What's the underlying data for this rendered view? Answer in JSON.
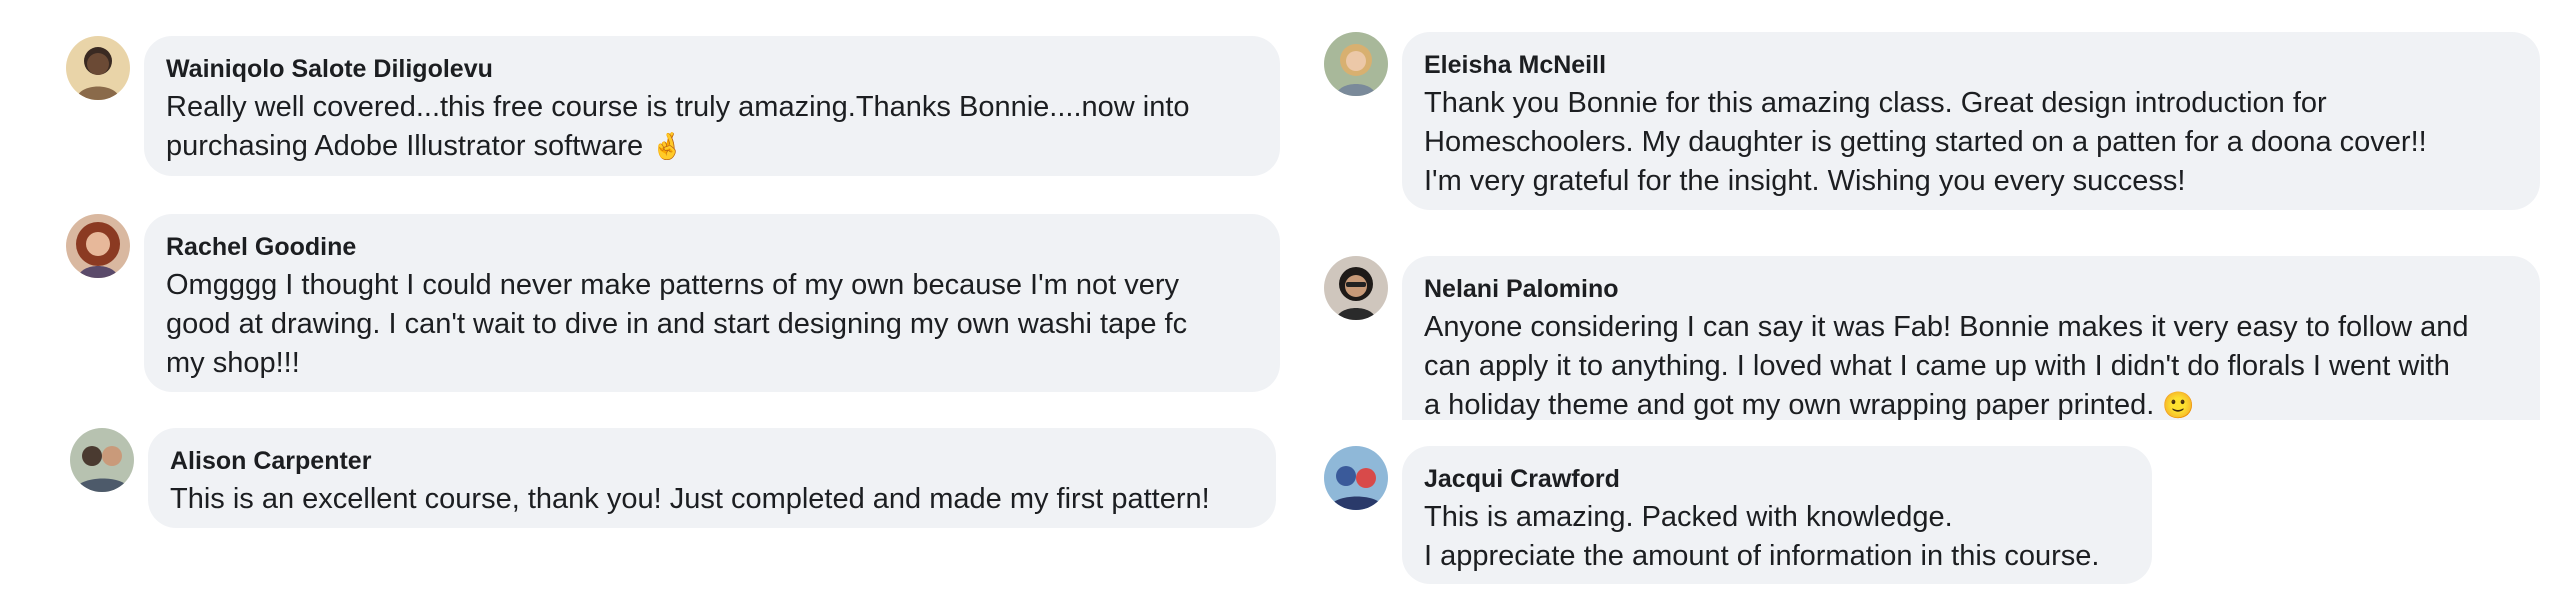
{
  "comments_left": [
    {
      "author": "Wainiqolo Salote Diligolevu",
      "lines": [
        "Really well covered...this free course is truly amazing.Thanks Bonnie....now into",
        "purchasing Adobe Illustrator software "
      ],
      "emoji": "🤞",
      "avatar_icon": "user-photo-icon"
    },
    {
      "author": "Rachel Goodine",
      "lines": [
        "Omgggg I thought I could never make patterns of my own because I'm not very",
        "good at drawing. I can't wait to dive in and start designing my own washi tape fc",
        "my shop!!!"
      ],
      "avatar_icon": "user-photo-icon"
    },
    {
      "author": "Alison Carpenter",
      "lines": [
        "This is an excellent course, thank you! Just completed and made my first pattern!"
      ],
      "avatar_icon": "user-photo-icon"
    }
  ],
  "comments_right": [
    {
      "author": "Eleisha McNeill",
      "lines": [
        "Thank you Bonnie for this amazing class. Great design introduction for",
        "Homeschoolers. My daughter is getting started on a patten for a doona cover!!",
        "I'm very grateful for the insight. Wishing you every success!"
      ],
      "avatar_icon": "user-photo-icon"
    },
    {
      "author": "Nelani Palomino",
      "lines": [
        "Anyone considering I can say it was Fab! Bonnie makes it very easy to follow and",
        "can apply it to anything. I loved what I came up with I didn't do florals I went with",
        "a holiday theme and got my own wrapping paper printed. "
      ],
      "emoji": "🙂",
      "avatar_icon": "user-photo-icon"
    },
    {
      "author": "Jacqui Crawford",
      "lines": [
        "This is amazing. Packed with knowledge.",
        "I appreciate the amount of information in this course."
      ],
      "avatar_icon": "user-photo-icon"
    }
  ],
  "colors": {
    "bubble_bg": "#f0f2f5",
    "text": "#1c1e21",
    "page_bg": "#ffffff"
  }
}
